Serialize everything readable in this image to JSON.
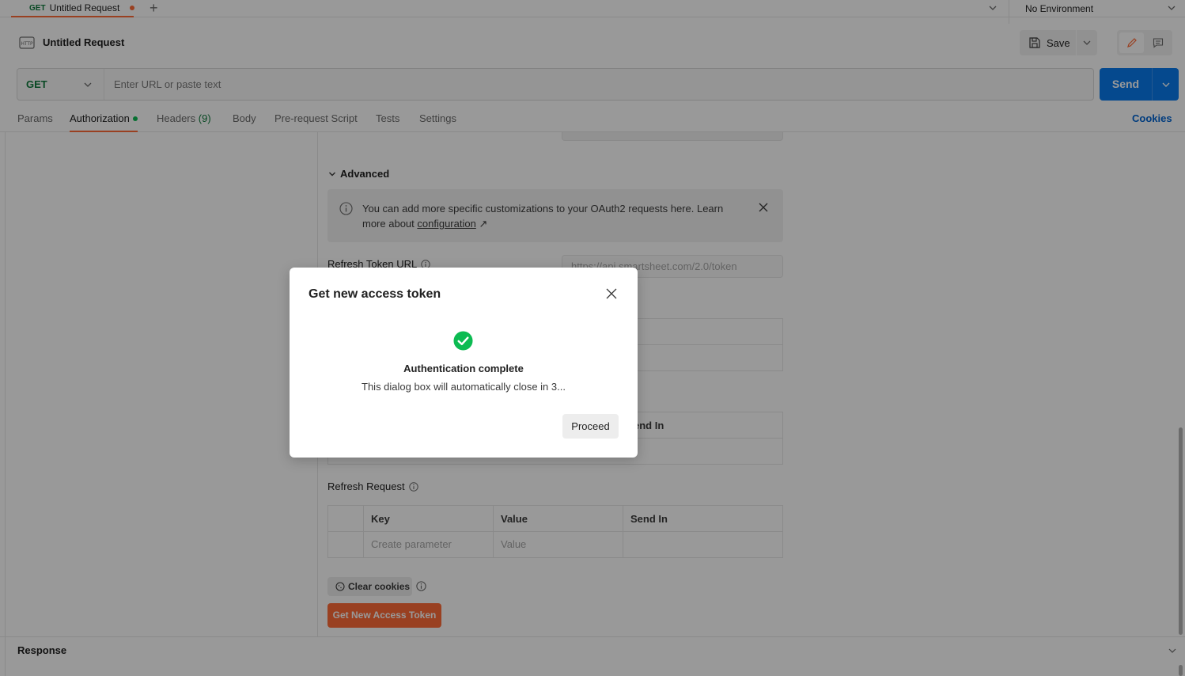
{
  "tab": {
    "method": "GET",
    "title": "Untitled Request"
  },
  "environment": {
    "label": "No Environment"
  },
  "request": {
    "title": "Untitled Request",
    "save_label": "Save"
  },
  "url_bar": {
    "method": "GET",
    "placeholder": "Enter URL or paste text",
    "send_label": "Send"
  },
  "request_tabs": {
    "params": "Params",
    "authorization": "Authorization",
    "headers": "Headers",
    "headers_count": "(9)",
    "body": "Body",
    "pre_request": "Pre-request Script",
    "tests": "Tests",
    "settings": "Settings",
    "cookies": "Cookies"
  },
  "auth": {
    "advanced_label": "Advanced",
    "info_text_1": "You can add more specific customizations to your OAuth2 requests here. Learn more about ",
    "info_link": "configuration",
    "info_arrow": "↗",
    "refresh_token_url_label": "Refresh Token URL",
    "refresh_token_url_value": "https://api.smartsheet.com/2.0/token",
    "refresh_request_label": "Refresh Request",
    "table": {
      "headers": [
        "Key",
        "Value",
        "Send In"
      ],
      "key_placeholder": "Create parameter",
      "value_placeholder": "Value"
    },
    "partial_header": "end In",
    "clear_cookies": "Clear cookies",
    "get_token": "Get New Access Token"
  },
  "response": {
    "title": "Response"
  },
  "modal": {
    "title": "Get new access token",
    "heading": "Authentication complete",
    "subtext": "This dialog box will automatically close in 3...",
    "proceed": "Proceed"
  },
  "colors": {
    "accent_orange": "#ff6c37",
    "send_blue": "#097bed",
    "method_green": "#0f7b3c",
    "success_green": "#0cbb52",
    "link_blue": "#0265d2"
  }
}
